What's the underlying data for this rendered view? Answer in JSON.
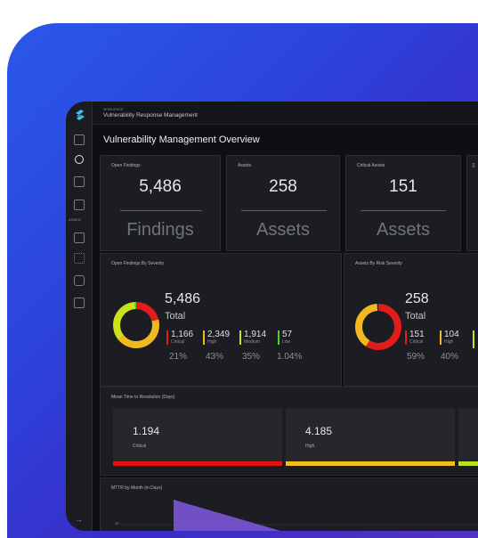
{
  "app": {
    "breadcrumb": "WORKSPACE",
    "title": "Vulnerability Response Management",
    "page_title": "Vulnerability Management Overview"
  },
  "sidebar": {
    "admin_label": "ADMIN",
    "icons": [
      "inbox-icon",
      "clock-icon",
      "table-icon",
      "document-icon",
      "grid-icon",
      "sparkle-icon",
      "book-icon",
      "dashboard-icon"
    ],
    "bottom_icon": "→"
  },
  "kpis": [
    {
      "label": "Open Findings",
      "value": "5,486",
      "unit": "Findings"
    },
    {
      "label": "Assets",
      "value": "258",
      "unit": "Assets"
    },
    {
      "label": "Critical Assets",
      "value": "151",
      "unit": "Assets"
    }
  ],
  "findings_severity": {
    "label": "Open Findings By Severity",
    "total": "5,486",
    "total_label": "Total",
    "items": [
      {
        "value": "1,166",
        "label": "Critical",
        "pct": "21%",
        "color": "#e21b1b"
      },
      {
        "value": "2,349",
        "label": "High",
        "pct": "43%",
        "color": "#f2b81f"
      },
      {
        "value": "1,914",
        "label": "Medium",
        "pct": "35%",
        "color": "#c9e21b"
      },
      {
        "value": "57",
        "label": "Low",
        "pct": "1.04%",
        "color": "#4ed32a"
      }
    ]
  },
  "assets_severity": {
    "label": "Assets By Risk Severity",
    "total": "258",
    "total_label": "Total",
    "items": [
      {
        "value": "151",
        "label": "Critical",
        "pct": "59%",
        "color": "#e21b1b"
      },
      {
        "value": "104",
        "label": "High",
        "pct": "40%",
        "color": "#f2b81f"
      }
    ]
  },
  "mttr": {
    "label": "Mean Time to Resolution (Days)",
    "items": [
      {
        "value": "1.194",
        "label": "Critical",
        "color": "#e11414"
      },
      {
        "value": "4.185",
        "label": "High",
        "color": "#f2bf1c"
      }
    ]
  },
  "mttr_month": {
    "label": "MTTR by Month (in Days)",
    "ytick": "30"
  }
}
